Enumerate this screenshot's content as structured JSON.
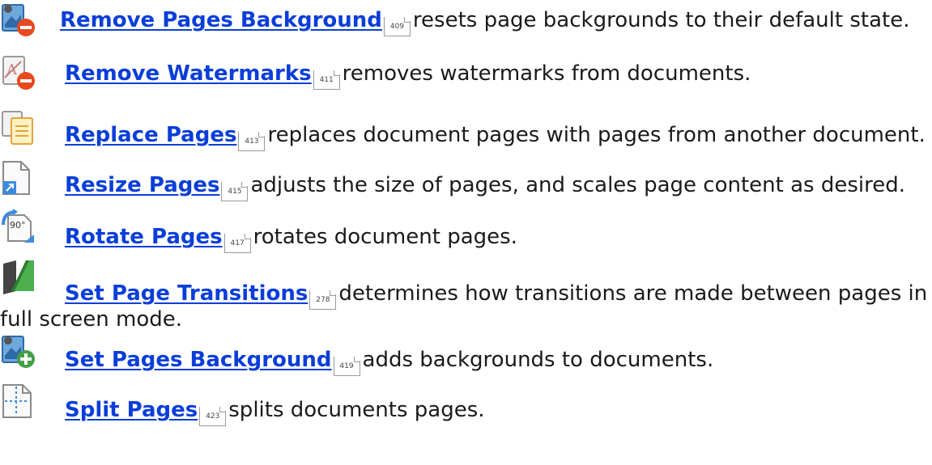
{
  "entries": [
    {
      "icon": "remove-background-icon",
      "link": "Remove Pages Background",
      "page": "409",
      "desc": "resets page backgrounds to their default state."
    },
    {
      "icon": "remove-watermark-icon",
      "link": "Remove Watermarks",
      "page": "411",
      "desc": "removes watermarks from documents."
    },
    {
      "icon": "replace-pages-icon",
      "link": "Replace Pages",
      "page": "413",
      "desc": "replaces document pages with pages from another document."
    },
    {
      "icon": "resize-pages-icon",
      "link": "Resize Pages",
      "page": "415",
      "desc": "adjusts the size of pages, and scales page content as desired."
    },
    {
      "icon": "rotate-pages-icon",
      "link": "Rotate Pages",
      "page": "417",
      "desc": "rotates document pages."
    },
    {
      "icon": "page-transitions-icon",
      "link": "Set Page Transitions",
      "page": "278",
      "desc": "determines how transitions are made between pages in",
      "desc_cont": "full screen mode."
    },
    {
      "icon": "set-background-icon",
      "link": "Set Pages Background",
      "page": "419",
      "desc": "adds backgrounds to documents."
    },
    {
      "icon": "split-pages-icon",
      "link": "Split Pages",
      "page": "423",
      "desc": "splits documents pages."
    }
  ]
}
